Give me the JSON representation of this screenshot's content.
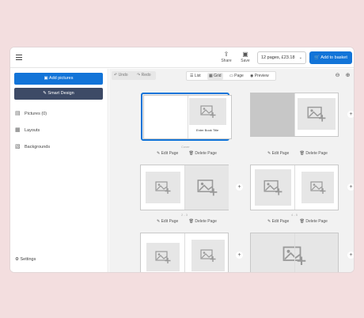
{
  "toolbar": {
    "share_label": "Share",
    "save_label": "Save",
    "price_select": "12 pages, £23.18",
    "add_basket_label": "Add to basket"
  },
  "sidebar": {
    "add_pictures": "Add pictures",
    "smart_design": "Smart Design",
    "items": [
      {
        "label": "Pictures (0)",
        "icon": "pictures-icon"
      },
      {
        "label": "Layouts",
        "icon": "layouts-icon"
      },
      {
        "label": "Backgrounds",
        "icon": "backgrounds-icon"
      }
    ],
    "settings": "Settings"
  },
  "editor": {
    "undo": "Undo",
    "redo": "Redo",
    "views": [
      "List",
      "Grid",
      "Page",
      "Preview"
    ],
    "active_view": "Grid",
    "cover_label": "Cover",
    "title_label": "Enter Book Title",
    "edit_page": "Edit Page",
    "delete_page": "Delete Page",
    "page_numbers": [
      "2 - 3",
      "4 - 5"
    ]
  },
  "colors": {
    "accent": "#1274d8",
    "smart": "#3d4a66",
    "background": "#f3dedf"
  }
}
